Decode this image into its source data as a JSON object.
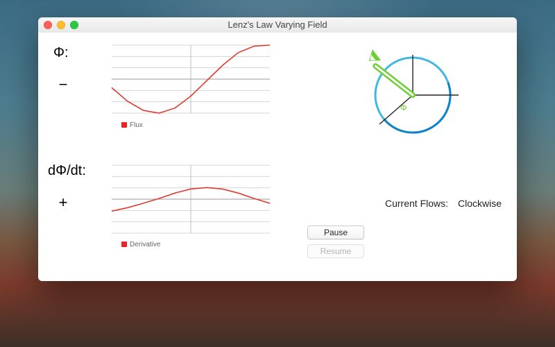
{
  "window": {
    "title": "Lenz's Law Varying Field"
  },
  "flux": {
    "label": "Φ:",
    "sign": "−",
    "legend": "Flux"
  },
  "deriv": {
    "label": "dΦ/dt:",
    "sign": "+",
    "legend": "Derivative"
  },
  "controls": {
    "pause": "Pause",
    "resume": "Resume"
  },
  "status": {
    "label": "Current Flows:",
    "value": "Clockwise"
  },
  "diagram": {
    "arrow_label": "Φ"
  },
  "colors": {
    "curve": "#e03a2f",
    "loop1": "#3eb7e6",
    "loop2": "#0f82c8",
    "arrow": "#6cce2f"
  },
  "chart_data": [
    {
      "type": "line",
      "title": "Flux",
      "xlabel": "",
      "ylabel": "",
      "ylim": [
        -1,
        1
      ],
      "series": [
        {
          "name": "Flux",
          "x": [
            0,
            0.1,
            0.2,
            0.3,
            0.4,
            0.5,
            0.6,
            0.7,
            0.8,
            0.9,
            1.0
          ],
          "values": [
            -0.25,
            -0.65,
            -0.92,
            -1.0,
            -0.85,
            -0.5,
            -0.05,
            0.4,
            0.78,
            0.97,
            1.0
          ]
        }
      ]
    },
    {
      "type": "line",
      "title": "Derivative",
      "xlabel": "",
      "ylabel": "",
      "ylim": [
        -1,
        1
      ],
      "series": [
        {
          "name": "Derivative",
          "x": [
            0,
            0.1,
            0.2,
            0.3,
            0.4,
            0.5,
            0.6,
            0.7,
            0.8,
            0.9,
            1.0
          ],
          "values": [
            -0.35,
            -0.25,
            -0.12,
            0.02,
            0.18,
            0.3,
            0.34,
            0.3,
            0.18,
            0.02,
            -0.12
          ]
        }
      ]
    }
  ]
}
